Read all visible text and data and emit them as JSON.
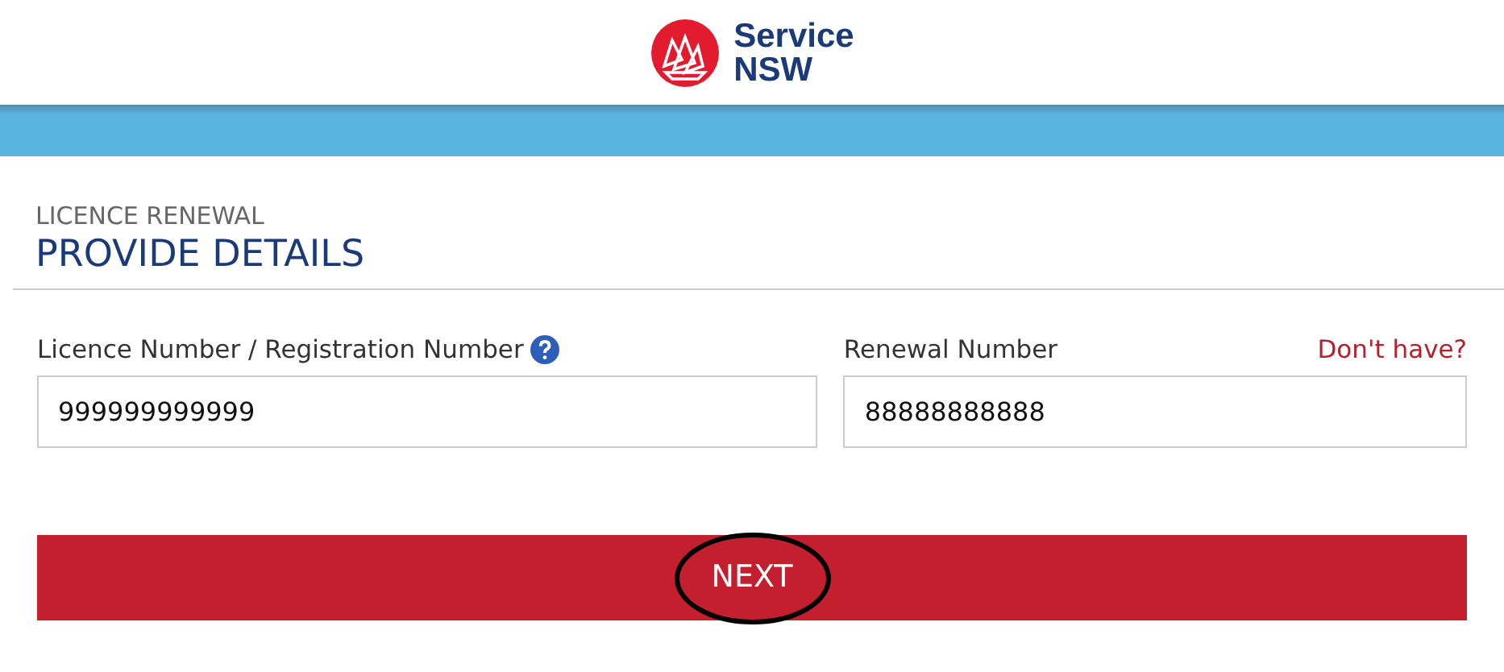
{
  "header": {
    "logo_line_1": "Service",
    "logo_line_2": "NSW"
  },
  "page": {
    "subtitle": "LICENCE RENEWAL",
    "title": "PROVIDE DETAILS"
  },
  "fields": [
    {
      "label": "Licence Number / Registration Number",
      "help": true,
      "value": "999999999999"
    },
    {
      "label": "Renewal Number",
      "help": false,
      "link": "Don't have?",
      "value": "88888888888"
    }
  ],
  "next_button": {
    "label": "NEXT",
    "circled": true
  }
}
